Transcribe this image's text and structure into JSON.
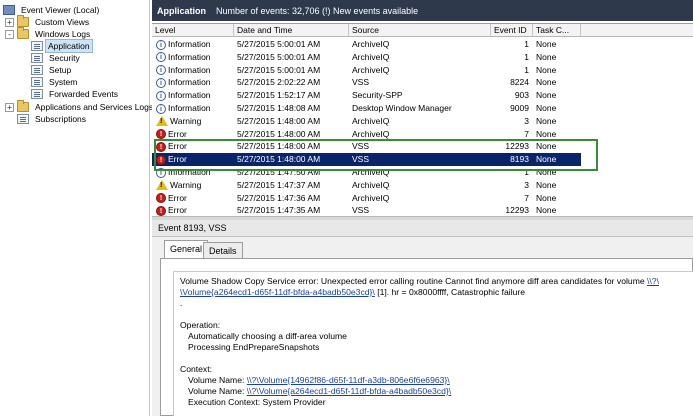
{
  "tree": {
    "items": [
      {
        "label": "Event Viewer (Local)",
        "icon": "event-viewer-icon"
      },
      {
        "label": "Custom Views",
        "expander": "+"
      },
      {
        "label": "Windows Logs",
        "expander": "-"
      },
      {
        "label": "Application",
        "selected": true
      },
      {
        "label": "Security"
      },
      {
        "label": "Setup"
      },
      {
        "label": "System"
      },
      {
        "label": "Forwarded Events"
      },
      {
        "label": "Applications and Services Logs",
        "expander": "+"
      },
      {
        "label": "Subscriptions"
      }
    ]
  },
  "header": {
    "title": "Application",
    "info": "Number of events: 32,706 (!) New events available"
  },
  "events": {
    "columns": [
      "Level",
      "Date and Time",
      "Source",
      "Event ID",
      "Task C..."
    ],
    "rows": [
      {
        "level": "Information",
        "date": "5/27/2015 5:00:01 AM",
        "source": "ArchiveIQ",
        "id": "1",
        "task": "None"
      },
      {
        "level": "Information",
        "date": "5/27/2015 5:00:01 AM",
        "source": "ArchiveIQ",
        "id": "1",
        "task": "None"
      },
      {
        "level": "Information",
        "date": "5/27/2015 5:00:01 AM",
        "source": "ArchiveIQ",
        "id": "1",
        "task": "None"
      },
      {
        "level": "Information",
        "date": "5/27/2015 2:02:22 AM",
        "source": "VSS",
        "id": "8224",
        "task": "None"
      },
      {
        "level": "Information",
        "date": "5/27/2015 1:52:17 AM",
        "source": "Security-SPP",
        "id": "903",
        "task": "None"
      },
      {
        "level": "Information",
        "date": "5/27/2015 1:48:08 AM",
        "source": "Desktop Window Manager",
        "id": "9009",
        "task": "None"
      },
      {
        "level": "Warning",
        "date": "5/27/2015 1:48:00 AM",
        "source": "ArchiveIQ",
        "id": "3",
        "task": "None"
      },
      {
        "level": "Error",
        "date": "5/27/2015 1:48:00 AM",
        "source": "ArchiveIQ",
        "id": "7",
        "task": "None"
      },
      {
        "level": "Error",
        "date": "5/27/2015 1:48:00 AM",
        "source": "VSS",
        "id": "12293",
        "task": "None"
      },
      {
        "level": "Error",
        "date": "5/27/2015 1:48:00 AM",
        "source": "VSS",
        "id": "8193",
        "task": "None",
        "selected": true
      },
      {
        "level": "Information",
        "date": "5/27/2015 1:47:50 AM",
        "source": "ArchiveIQ",
        "id": "1",
        "task": "None"
      },
      {
        "level": "Warning",
        "date": "5/27/2015 1:47:37 AM",
        "source": "ArchiveIQ",
        "id": "3",
        "task": "None"
      },
      {
        "level": "Error",
        "date": "5/27/2015 1:47:36 AM",
        "source": "ArchiveIQ",
        "id": "7",
        "task": "None"
      },
      {
        "level": "Error",
        "date": "5/27/2015 1:47:35 AM",
        "source": "VSS",
        "id": "12293",
        "task": "None"
      }
    ]
  },
  "detail": {
    "title": "Event 8193, VSS",
    "tabs": [
      "General",
      "Details"
    ],
    "line1": "Volume Shadow Copy Service error: Unexpected error calling routine Cannot find anymore diff area candidates for volume",
    "link1a": "\\\\?\\",
    "link1b": "\\Volume{a264ecd1-d65f-11df-bfda-a4badb50e3cd}\\",
    "line2": "[1].  hr = 0x8000ffff, Catastrophic failure",
    "dot": ".",
    "op_label": "Operation:",
    "op1": "Automatically choosing a diff-area volume",
    "op2": "Processing EndPrepareSnapshots",
    "ctx_label": "Context:",
    "vol_label1": "Volume Name:",
    "vol_link1": "\\\\?\\Volume{14962f86-d65f-11df-a3db-806e6f6e6963}\\",
    "vol_label2": "Volume Name:",
    "vol_link2": "\\\\?\\Volume{a264ecd1-d65f-11df-bfda-a4badb50e3cd}\\",
    "exec_ctx": "Execution Context: System Provider"
  },
  "colors": {
    "header_bg": "#2e3a4b",
    "selected_row": "#0a246a",
    "highlight_border": "#3a8a3a",
    "error_icon": "#c0231d",
    "warning_icon": "#e8b81a"
  }
}
